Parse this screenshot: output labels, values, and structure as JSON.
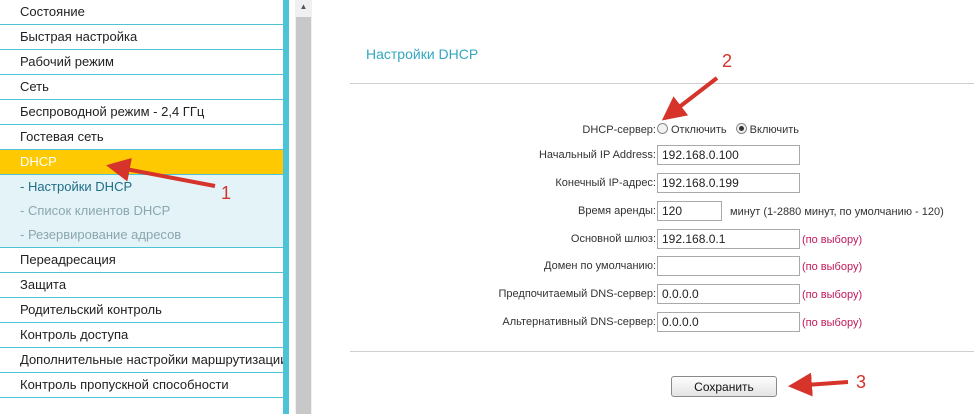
{
  "sidebar": {
    "items_before": [
      "Состояние",
      "Быстрая настройка",
      "Рабочий режим",
      "Сеть",
      "Беспроводной режим - 2,4 ГГц",
      "Гостевая сеть"
    ],
    "active": "DHCP",
    "subitems": [
      "- Настройки DHCP",
      "- Список клиентов DHCP",
      "- Резервирование адресов"
    ],
    "items_after": [
      "Переадресация",
      "Защита",
      "Родительский контроль",
      "Контроль доступа",
      "Дополнительные настройки маршрутизации",
      "Контроль пропускной способности"
    ]
  },
  "main": {
    "title": "Настройки DHCP",
    "dhcp_server": {
      "label": "DHCP-сервер:",
      "opt_off": "Отключить",
      "opt_on": "Включить",
      "selected": "on"
    },
    "start_ip": {
      "label": "Начальный IP Address:",
      "value": "192.168.0.100"
    },
    "end_ip": {
      "label": "Конечный IP-адрес:",
      "value": "192.168.0.199"
    },
    "lease": {
      "label": "Время аренды:",
      "value": "120",
      "note": "минут (1-2880 минут, по умолчанию - 120)"
    },
    "gateway": {
      "label": "Основной шлюз:",
      "value": "192.168.0.1",
      "optional": "(по выбору)"
    },
    "domain": {
      "label": "Домен по умолчанию:",
      "value": "",
      "optional": "(по выбору)"
    },
    "dns1": {
      "label": "Предпочитаемый DNS-сервер:",
      "value": "0.0.0.0",
      "optional": "(по выбору)"
    },
    "dns2": {
      "label": "Альтернативный DNS-сервер:",
      "value": "0.0.0.0",
      "optional": "(по выбору)"
    },
    "save_label": "Сохранить"
  },
  "annotations": {
    "n1": "1",
    "n2": "2",
    "n3": "3",
    "color": "#d6332a"
  },
  "colors": {
    "accent": "#4fc3d6",
    "active": "#fec900",
    "title": "#33a8c0",
    "optional": "#c2185b"
  }
}
